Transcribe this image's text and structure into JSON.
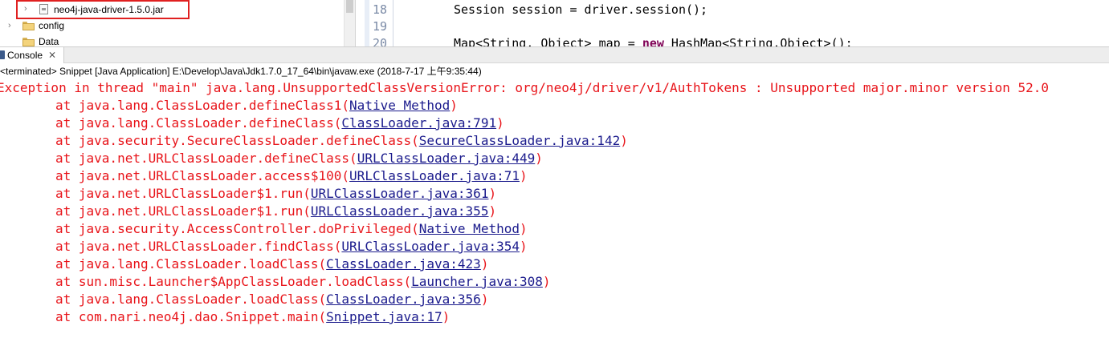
{
  "tree": {
    "items": [
      {
        "label": "neo4j-java-driver-1.5.0.jar",
        "icon": "jar-file-icon",
        "highlighted": true
      },
      {
        "label": "config",
        "icon": "folder-icon"
      },
      {
        "label": "Data",
        "icon": "folder-icon"
      }
    ],
    "highlight_color": "#e02020"
  },
  "editor": {
    "line_numbers": [
      "18",
      "19",
      "20"
    ],
    "lines": [
      "Session session = driver.session();",
      "",
      "Map<String, Object> map = new HashMap<String,Object>();"
    ]
  },
  "console": {
    "tab_label": "Console",
    "close_glyph": "⨯",
    "status": "<terminated> Snippet [Java Application] E:\\Develop\\Java\\Jdk1.7.0_17_64\\bin\\javaw.exe (2018-7-17 上午9:35:44)",
    "error_color": "#e8141a",
    "link_color": "#1a1a8c",
    "exception": "Exception in thread \"main\" java.lang.UnsupportedClassVersionError: org/neo4j/driver/v1/AuthTokens : Unsupported major.minor version 52.0",
    "frames": [
      {
        "text": "at java.lang.ClassLoader.defineClass1(",
        "link": "Native Method",
        "end": ")"
      },
      {
        "text": "at java.lang.ClassLoader.defineClass(",
        "link": "ClassLoader.java:791",
        "end": ")"
      },
      {
        "text": "at java.security.SecureClassLoader.defineClass(",
        "link": "SecureClassLoader.java:142",
        "end": ")"
      },
      {
        "text": "at java.net.URLClassLoader.defineClass(",
        "link": "URLClassLoader.java:449",
        "end": ")"
      },
      {
        "text": "at java.net.URLClassLoader.access$100(",
        "link": "URLClassLoader.java:71",
        "end": ")"
      },
      {
        "text": "at java.net.URLClassLoader$1.run(",
        "link": "URLClassLoader.java:361",
        "end": ")"
      },
      {
        "text": "at java.net.URLClassLoader$1.run(",
        "link": "URLClassLoader.java:355",
        "end": ")"
      },
      {
        "text": "at java.security.AccessController.doPrivileged(",
        "link": "Native Method",
        "end": ")"
      },
      {
        "text": "at java.net.URLClassLoader.findClass(",
        "link": "URLClassLoader.java:354",
        "end": ")"
      },
      {
        "text": "at java.lang.ClassLoader.loadClass(",
        "link": "ClassLoader.java:423",
        "end": ")"
      },
      {
        "text": "at sun.misc.Launcher$AppClassLoader.loadClass(",
        "link": "Launcher.java:308",
        "end": ")"
      },
      {
        "text": "at java.lang.ClassLoader.loadClass(",
        "link": "ClassLoader.java:356",
        "end": ")"
      },
      {
        "text": "at com.nari.neo4j.dao.Snippet.main(",
        "link": "Snippet.java:17",
        "end": ")"
      }
    ]
  }
}
